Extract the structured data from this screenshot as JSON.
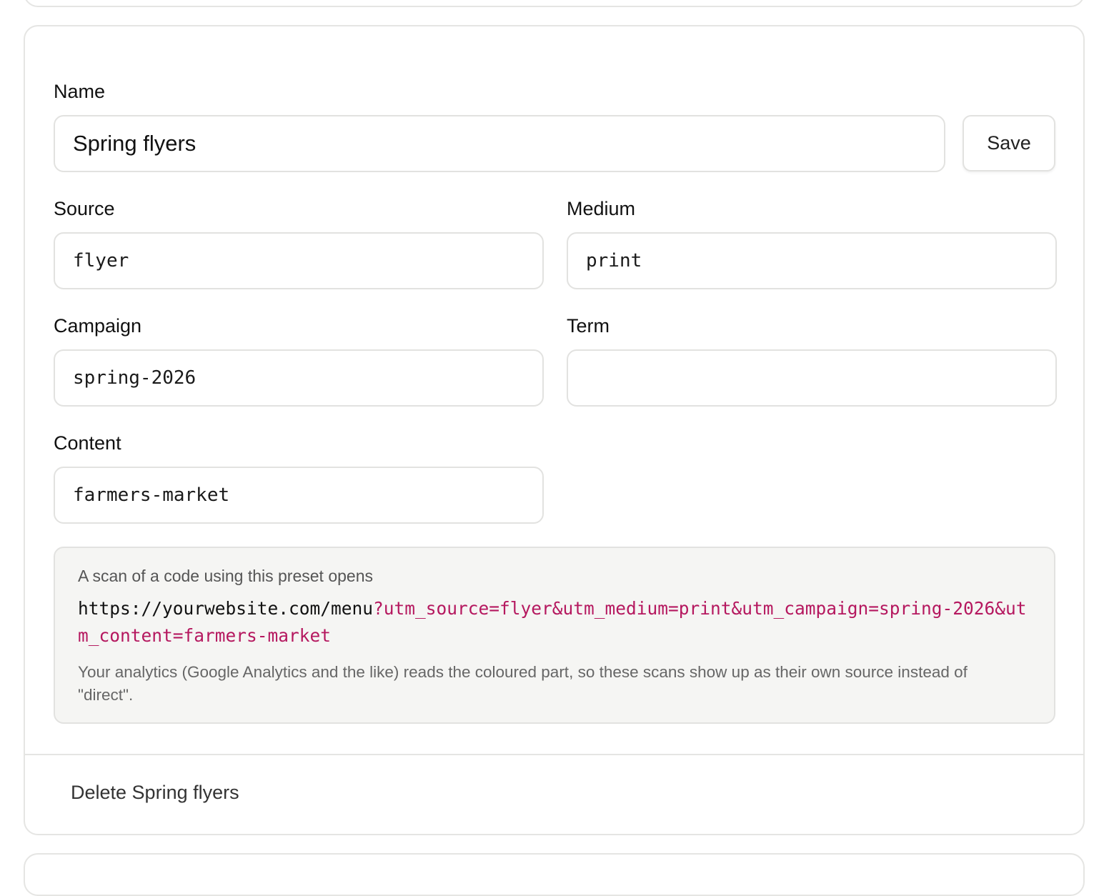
{
  "form": {
    "name": {
      "label": "Name",
      "value": "Spring flyers"
    },
    "save_label": "Save",
    "source": {
      "label": "Source",
      "value": "flyer"
    },
    "medium": {
      "label": "Medium",
      "value": "print"
    },
    "campaign": {
      "label": "Campaign",
      "value": "spring-2026"
    },
    "term": {
      "label": "Term",
      "value": ""
    },
    "content": {
      "label": "Content",
      "value": "farmers-market"
    }
  },
  "preview": {
    "intro": "A scan of a code using this preset opens",
    "url_base": "https://yourwebsite.com/menu",
    "url_params": "?utm_source=flyer&utm_medium=print&utm_campaign=spring-2026&utm_content=farmers-market",
    "note": "Your analytics (Google Analytics and the like) reads the coloured part, so these scans show up as their own source instead of \"direct\"."
  },
  "delete_label": "Delete Spring flyers",
  "colors": {
    "params_accent": "#b5185f",
    "border": "#e2e2e0",
    "preview_bg": "#f5f5f3"
  }
}
